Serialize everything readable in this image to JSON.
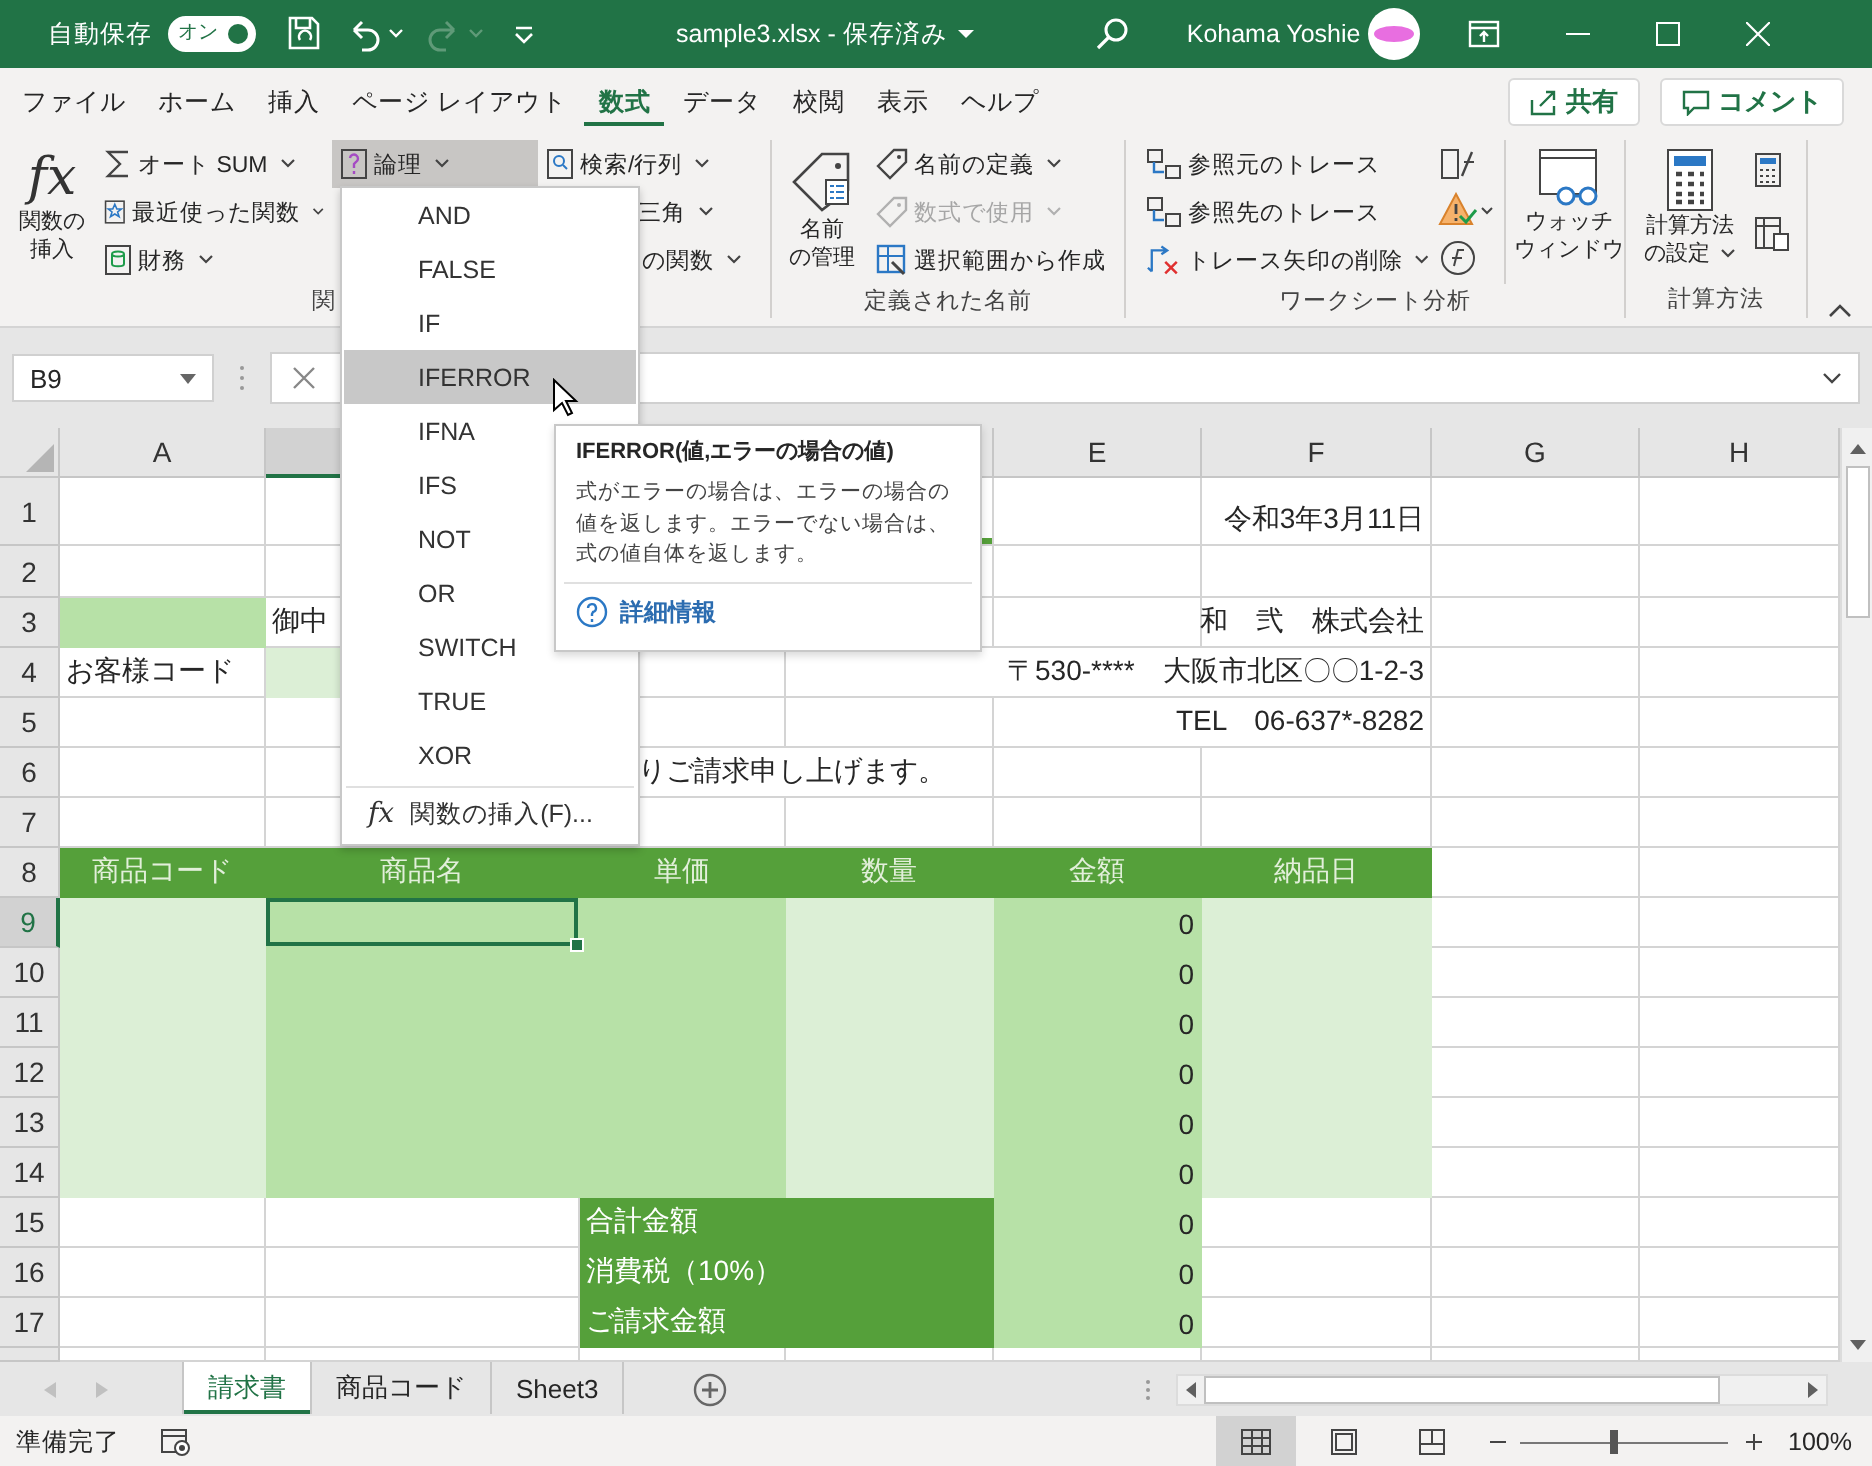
{
  "title_bar": {
    "autosave_label": "自動保存",
    "autosave_toggle": {
      "label": "オン",
      "on": true
    },
    "title": "sample3.xlsx - 保存済み",
    "user": "Kohama Yoshie"
  },
  "ribbon_tabs": [
    {
      "label": "ファイル",
      "selected": false
    },
    {
      "label": "ホーム",
      "selected": false
    },
    {
      "label": "挿入",
      "selected": false
    },
    {
      "label": "ページ レイアウト",
      "selected": false
    },
    {
      "label": "数式",
      "selected": true
    },
    {
      "label": "データ",
      "selected": false
    },
    {
      "label": "校閲",
      "selected": false
    },
    {
      "label": "表示",
      "selected": false
    },
    {
      "label": "ヘルプ",
      "selected": false
    }
  ],
  "share_button": "共有",
  "comment_button": "コメント",
  "ribbon": {
    "function_library": {
      "label": "関",
      "insert_function": {
        "icon": "fx",
        "lines": [
          "関数の",
          "挿入"
        ]
      },
      "items": [
        {
          "label": "オート SUM",
          "menu": true,
          "pressed": false
        },
        {
          "label": "最近使った関数",
          "menu": true,
          "pressed": false
        },
        {
          "label": "財務",
          "menu": true,
          "pressed": false
        },
        {
          "label": "論理",
          "menu": true,
          "pressed": true
        },
        {
          "label": "検索/行列",
          "menu": true,
          "pressed": false
        },
        {
          "label": "三角",
          "menu": true,
          "pressed": false
        },
        {
          "label": "の関数",
          "menu": true,
          "pressed": false
        }
      ]
    },
    "defined_names": {
      "label": "定義された名前",
      "name_manager": [
        "名前",
        "の管理"
      ],
      "items": [
        {
          "label": "名前の定義",
          "menu": true,
          "disabled": false
        },
        {
          "label": "数式で使用",
          "menu": true,
          "disabled": true
        },
        {
          "label": "選択範囲から作成",
          "menu": false,
          "disabled": false
        }
      ]
    },
    "formula_auditing": {
      "label": "ワークシート分析",
      "items": [
        {
          "label": "参照元のトレース",
          "menu": false
        },
        {
          "label": "参照先のトレース",
          "menu": false
        },
        {
          "label": "トレース矢印の削除",
          "menu": true
        }
      ],
      "watch_window": [
        "ウォッチ",
        "ウィンドウ"
      ]
    },
    "calculation": {
      "label": "計算方法",
      "options": {
        "lines": [
          "計算方法",
          "の設定"
        ],
        "menu": true
      }
    }
  },
  "formula_bar": {
    "name_box": "B9"
  },
  "columns": [
    {
      "label": "A",
      "kind": "shown",
      "selected": false
    },
    {
      "kind": "shown",
      "selected": true
    },
    {
      "kind": "hidden",
      "selected": false
    },
    {
      "kind": "shown",
      "selected": false
    },
    {
      "label": "E",
      "kind": "shown",
      "selected": false
    },
    {
      "label": "F",
      "kind": "shown",
      "selected": false
    },
    {
      "label": "G",
      "kind": "shown",
      "selected": false
    },
    {
      "label": "H",
      "kind": "shown",
      "selected": false
    }
  ],
  "rows": [
    {
      "number": "1",
      "selected": false,
      "cells": [
        {
          "kind": "plain"
        },
        {
          "kind": "plain"
        },
        {
          "kind": "hidden"
        },
        {
          "kind": "underline"
        },
        {
          "kind": "plain"
        },
        {
          "text": "令和3年3月11日",
          "kind": "right"
        }
      ]
    },
    {
      "number": "2",
      "selected": false,
      "cells": [
        {
          "kind": "plain"
        },
        {
          "kind": "plain"
        },
        {
          "kind": "hidden"
        }
      ]
    },
    {
      "number": "3",
      "selected": false,
      "cells": [
        {
          "kind": "mid"
        },
        {
          "text": "御中",
          "kind": "plain"
        },
        {
          "kind": "hidden"
        },
        {
          "kind": "plain"
        },
        {
          "kind": "plain"
        },
        {
          "text": "和　弐　株式会社",
          "kind": "right"
        }
      ]
    },
    {
      "number": "4",
      "selected": false,
      "cells": [
        {
          "text": "お客様コード",
          "kind": "plain"
        },
        {
          "kind": "pale"
        },
        {
          "kind": "plain"
        },
        {
          "kind": "covered"
        },
        {
          "kind": "covered"
        },
        {
          "text": "〒530-****　大阪市北区〇〇1-2-3",
          "kind": "right"
        }
      ]
    },
    {
      "number": "5",
      "selected": false,
      "cells": [
        {
          "kind": "plain"
        },
        {
          "kind": "plain"
        },
        {
          "kind": "plain"
        },
        {
          "kind": "plain"
        },
        {
          "kind": "covered"
        },
        {
          "text": "TEL　06-637*-8282",
          "kind": "right"
        }
      ]
    },
    {
      "number": "6",
      "selected": false,
      "cells": [
        {
          "kind": "plain"
        },
        {
          "kind": "plain"
        },
        {
          "text": "りご請求申し上げます。",
          "kind": "indent"
        },
        {
          "kind": "covered"
        }
      ]
    },
    {
      "number": "7",
      "selected": false
    },
    {
      "number": "8",
      "selected": false,
      "cells": [
        {
          "text": "商品コード",
          "kind": "head"
        },
        {
          "text": "商品名",
          "kind": "head"
        },
        {
          "text": "単価",
          "kind": "head"
        },
        {
          "text": "数量",
          "kind": "head"
        },
        {
          "text": "金額",
          "kind": "head"
        },
        {
          "text": "納品日",
          "kind": "head"
        }
      ]
    },
    {
      "number": "9",
      "selected": true,
      "cells": [
        {
          "kind": "pale"
        },
        {
          "kind": "mid"
        },
        {
          "kind": "mid"
        },
        {
          "kind": "pale"
        },
        {
          "text": "0",
          "kind": "mid-right"
        },
        {
          "kind": "pale"
        }
      ]
    },
    {
      "number": "10",
      "selected": false,
      "cells": [
        {
          "kind": "pale"
        },
        {
          "kind": "mid"
        },
        {
          "kind": "mid"
        },
        {
          "kind": "pale"
        },
        {
          "text": "0",
          "kind": "mid-right"
        },
        {
          "kind": "pale"
        }
      ]
    },
    {
      "number": "11",
      "selected": false,
      "cells": [
        {
          "kind": "pale"
        },
        {
          "kind": "mid"
        },
        {
          "kind": "mid"
        },
        {
          "kind": "pale"
        },
        {
          "text": "0",
          "kind": "mid-right"
        },
        {
          "kind": "pale"
        }
      ]
    },
    {
      "number": "12",
      "selected": false,
      "cells": [
        {
          "kind": "pale"
        },
        {
          "kind": "mid"
        },
        {
          "kind": "mid"
        },
        {
          "kind": "pale"
        },
        {
          "text": "0",
          "kind": "mid-right"
        },
        {
          "kind": "pale"
        }
      ]
    },
    {
      "number": "13",
      "selected": false,
      "cells": [
        {
          "kind": "pale"
        },
        {
          "kind": "mid"
        },
        {
          "kind": "mid"
        },
        {
          "kind": "pale"
        },
        {
          "text": "0",
          "kind": "mid-right"
        },
        {
          "kind": "pale"
        }
      ]
    },
    {
      "number": "14",
      "selected": false,
      "cells": [
        {
          "kind": "pale"
        },
        {
          "kind": "mid"
        },
        {
          "kind": "mid"
        },
        {
          "kind": "pale"
        },
        {
          "text": "0",
          "kind": "mid-right"
        },
        {
          "kind": "pale"
        }
      ]
    },
    {
      "number": "15",
      "selected": false,
      "cells": [
        {
          "kind": "plain"
        },
        {
          "kind": "plain"
        },
        {
          "text": "合計金額",
          "kind": "total"
        },
        {
          "kind": "total"
        },
        {
          "text": "0",
          "kind": "mid-right"
        }
      ]
    },
    {
      "number": "16",
      "selected": false,
      "cells": [
        {
          "kind": "plain"
        },
        {
          "kind": "plain"
        },
        {
          "text": "消費税（10%）",
          "kind": "total"
        },
        {
          "kind": "total"
        },
        {
          "text": "0",
          "kind": "mid-right"
        }
      ]
    },
    {
      "number": "17",
      "selected": false,
      "cells": [
        {
          "kind": "plain"
        },
        {
          "kind": "plain"
        },
        {
          "text": "ご請求金額",
          "kind": "total"
        },
        {
          "kind": "total"
        },
        {
          "text": "0",
          "kind": "mid-right"
        }
      ]
    }
  ],
  "logical_menu": {
    "items": [
      {
        "label": "AND",
        "selected": false
      },
      {
        "label": "FALSE",
        "selected": false
      },
      {
        "label": "IF",
        "selected": false
      },
      {
        "label": "IFERROR",
        "selected": true
      },
      {
        "label": "IFNA",
        "selected": false
      },
      {
        "label": "IFS",
        "selected": false
      },
      {
        "label": "NOT",
        "selected": false
      },
      {
        "label": "OR",
        "selected": false
      },
      {
        "label": "SWITCH",
        "selected": false
      },
      {
        "label": "TRUE",
        "selected": false
      },
      {
        "label": "XOR",
        "selected": false
      }
    ],
    "footer": {
      "icon": "fx",
      "label": "関数の挿入(F)..."
    }
  },
  "tooltip": {
    "title": "IFERROR(値,エラーの場合の値)",
    "body": "式がエラーの場合は、エラーの場合の値を返します。エラーでない場合は、式の値自体を返します。",
    "link": "詳細情報"
  },
  "sheet_tabs": [
    {
      "label": "請求書",
      "selected": true
    },
    {
      "label": "商品コード",
      "selected": false
    },
    {
      "label": "Sheet3",
      "selected": false
    }
  ],
  "status_bar": {
    "text": "準備完了",
    "views": [
      {
        "selected": true
      },
      {
        "selected": false
      },
      {
        "selected": false
      }
    ],
    "zoom": {
      "level": 0.45,
      "reading": "100%"
    }
  }
}
